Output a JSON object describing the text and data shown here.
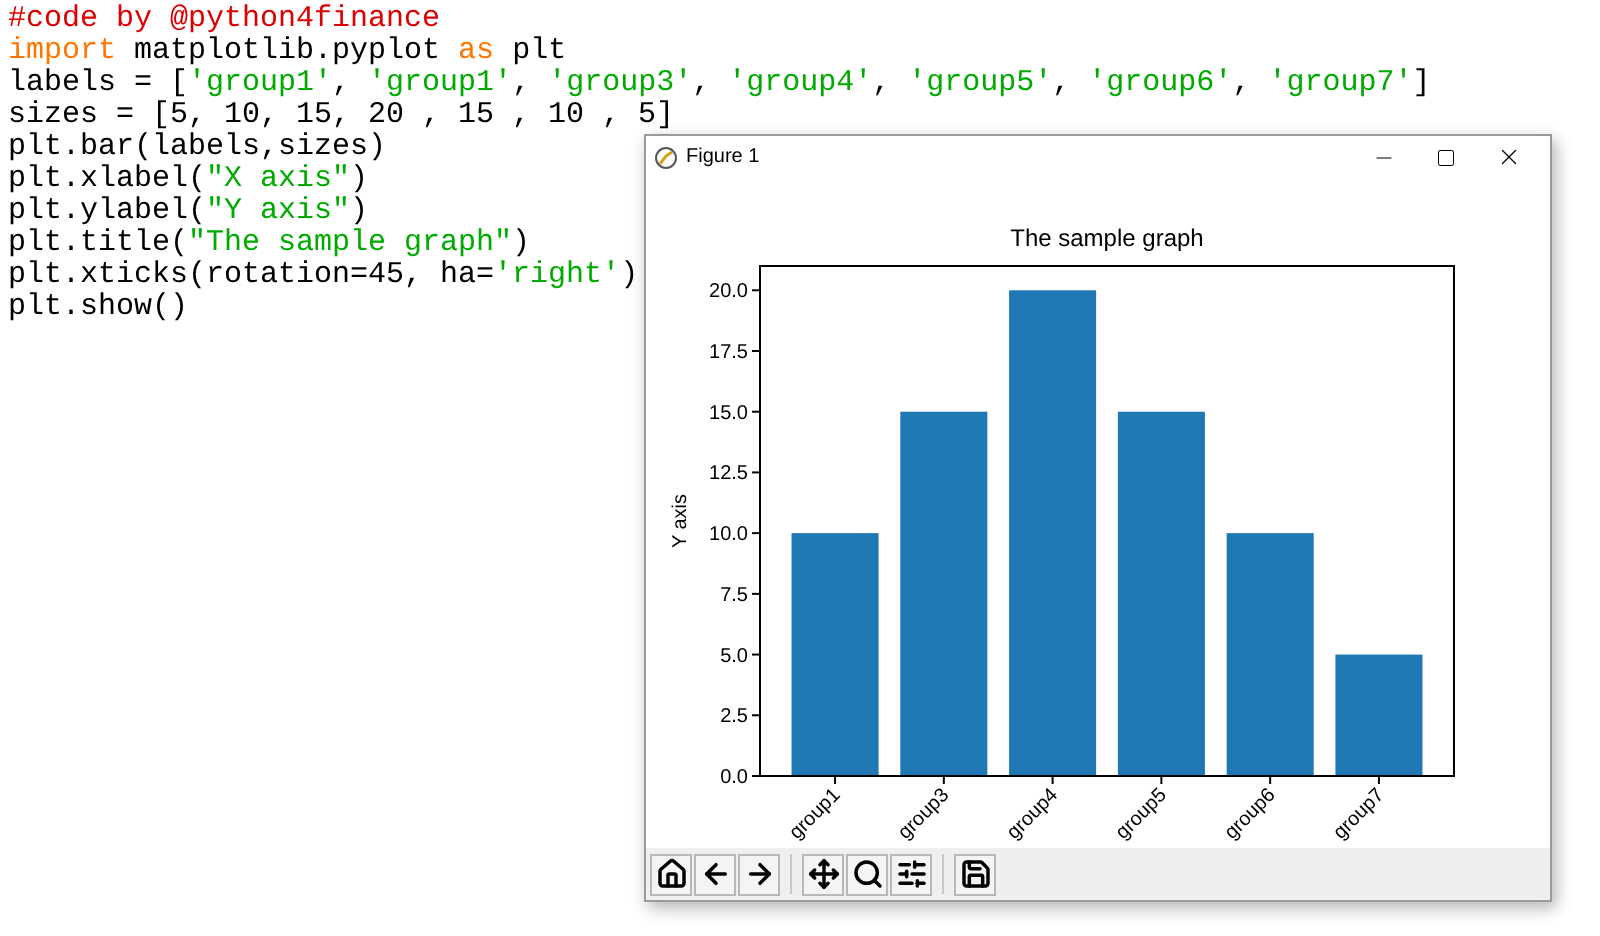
{
  "editor": {
    "lines": [
      [
        {
          "kind": "comment",
          "text": "#code by @python4finance"
        }
      ],
      [
        {
          "kind": "keyword",
          "text": "import"
        },
        {
          "kind": "plain",
          "text": " matplotlib.pyplot "
        },
        {
          "kind": "keyword",
          "text": "as"
        },
        {
          "kind": "plain",
          "text": " plt"
        }
      ],
      [
        {
          "kind": "plain",
          "text": "labels = ["
        },
        {
          "kind": "string",
          "text": "'group1'"
        },
        {
          "kind": "plain",
          "text": ", "
        },
        {
          "kind": "string",
          "text": "'group1'"
        },
        {
          "kind": "plain",
          "text": ", "
        },
        {
          "kind": "string",
          "text": "'group3'"
        },
        {
          "kind": "plain",
          "text": ", "
        },
        {
          "kind": "string",
          "text": "'group4'"
        },
        {
          "kind": "plain",
          "text": ", "
        },
        {
          "kind": "string",
          "text": "'group5'"
        },
        {
          "kind": "plain",
          "text": ", "
        },
        {
          "kind": "string",
          "text": "'group6'"
        },
        {
          "kind": "plain",
          "text": ", "
        },
        {
          "kind": "string",
          "text": "'group7'"
        },
        {
          "kind": "plain",
          "text": "]"
        }
      ],
      [
        {
          "kind": "plain",
          "text": "sizes = [5, 10, 15, 20 , 15 , 10 , 5]"
        }
      ],
      [
        {
          "kind": "plain",
          "text": "plt.bar(labels,sizes)"
        }
      ],
      [
        {
          "kind": "plain",
          "text": "plt.xlabel("
        },
        {
          "kind": "string",
          "text": "\"X axis\""
        },
        {
          "kind": "plain",
          "text": ")"
        }
      ],
      [
        {
          "kind": "plain",
          "text": "plt.ylabel("
        },
        {
          "kind": "string",
          "text": "\"Y axis\""
        },
        {
          "kind": "plain",
          "text": ")"
        }
      ],
      [
        {
          "kind": "plain",
          "text": "plt.title("
        },
        {
          "kind": "string",
          "text": "\"The sample graph\""
        },
        {
          "kind": "plain",
          "text": ")"
        }
      ],
      [
        {
          "kind": "plain",
          "text": "plt.xticks(rotation=45, ha="
        },
        {
          "kind": "string",
          "text": "'right'"
        },
        {
          "kind": "plain",
          "text": ")"
        }
      ],
      [
        {
          "kind": "plain",
          "text": "plt.show()"
        }
      ]
    ]
  },
  "figure_window": {
    "title": "Figure 1",
    "chart_data": {
      "type": "bar",
      "title": "The sample graph",
      "ylabel": "Y axis",
      "categories": [
        "group1",
        "group3",
        "group4",
        "group5",
        "group6",
        "group7"
      ],
      "values": [
        10,
        15,
        20,
        15,
        10,
        5
      ],
      "ylim": [
        0,
        21
      ],
      "yticks": [
        {
          "value": 0,
          "label": "0.0"
        },
        {
          "value": 2.5,
          "label": "2.5"
        },
        {
          "value": 5,
          "label": "5.0"
        },
        {
          "value": 7.5,
          "label": "7.5"
        },
        {
          "value": 10,
          "label": "10.0"
        },
        {
          "value": 12.5,
          "label": "12.5"
        },
        {
          "value": 15,
          "label": "15.0"
        },
        {
          "value": 17.5,
          "label": "17.5"
        },
        {
          "value": 20,
          "label": "20.0"
        }
      ]
    }
  }
}
